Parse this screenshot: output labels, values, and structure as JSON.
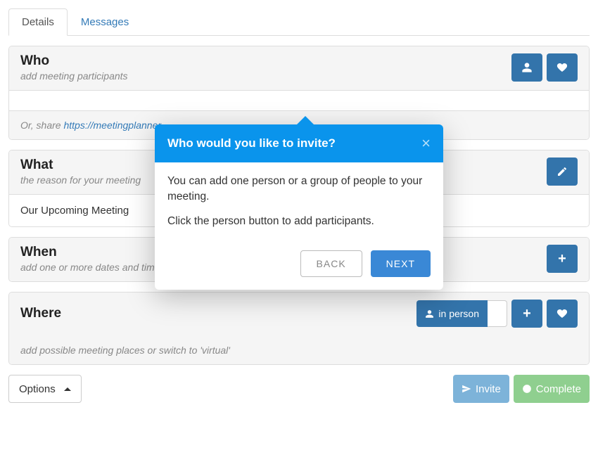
{
  "tabs": {
    "details": "Details",
    "messages": "Messages"
  },
  "who": {
    "title": "Who",
    "sub": "add meeting participants",
    "share_prefix": "Or, share ",
    "share_link": "https://meetingplanner..."
  },
  "what": {
    "title": "What",
    "sub": "the reason for your meeting",
    "subject": "Our Upcoming Meeting"
  },
  "when": {
    "title": "When",
    "sub": "add one or more dates and times for participants to choose from"
  },
  "where": {
    "title": "Where",
    "sub": "add possible meeting places or switch to 'virtual'",
    "mode_label": "in person"
  },
  "footer": {
    "options": "Options",
    "invite": "Invite",
    "complete": "Complete"
  },
  "popover": {
    "title": "Who would you like to invite?",
    "p1": "You can add one person or a group of people to your meeting.",
    "p2": "Click the person button to add participants.",
    "back": "BACK",
    "next": "NEXT"
  }
}
